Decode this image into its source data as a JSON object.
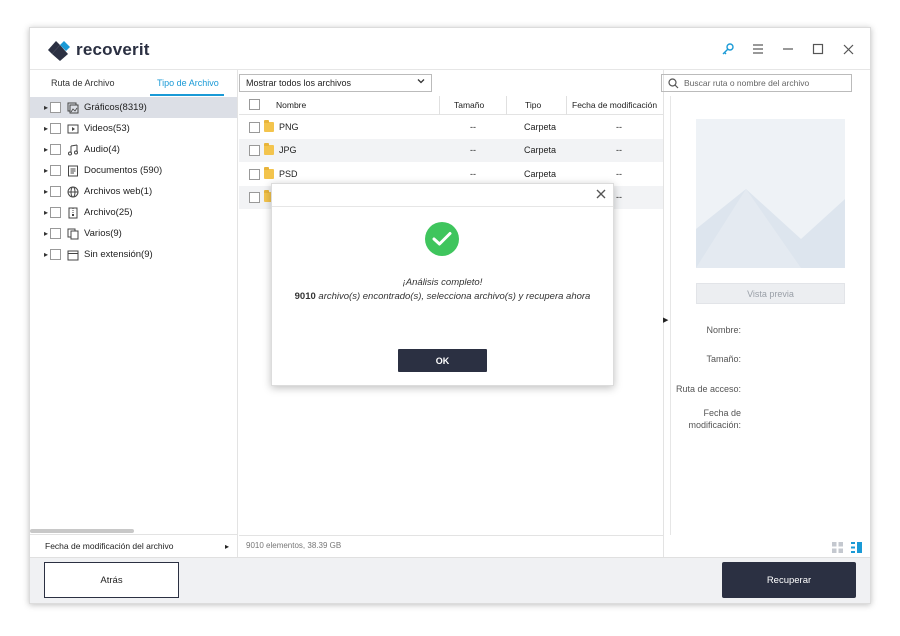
{
  "app": {
    "name": "recoverit"
  },
  "title_controls": [
    "key-icon",
    "menu-icon",
    "minimize-icon",
    "maximize-icon",
    "close-icon"
  ],
  "sidebar": {
    "tabs": [
      {
        "label": "Ruta de Archivo",
        "active": false
      },
      {
        "label": "Tipo de Archivo",
        "active": true
      }
    ],
    "items": [
      {
        "label": "Gráficos(8319)",
        "icon": "image-icon",
        "selected": true
      },
      {
        "label": "Videos(53)",
        "icon": "video-icon",
        "selected": false
      },
      {
        "label": "Audio(4)",
        "icon": "music-icon",
        "selected": false
      },
      {
        "label": "Documentos  (590)",
        "icon": "document-icon",
        "selected": false
      },
      {
        "label": "Archivos web(1)",
        "icon": "globe-icon",
        "selected": false
      },
      {
        "label": "Archivo(25)",
        "icon": "archive-icon",
        "selected": false
      },
      {
        "label": "Varios(9)",
        "icon": "misc-files-icon",
        "selected": false
      },
      {
        "label": "Sin extensión(9)",
        "icon": "blank-file-icon",
        "selected": false
      }
    ],
    "footer_label": "Fecha de modificación del archivo"
  },
  "main": {
    "filter": "Mostrar todos los archivos",
    "columns": [
      "Nombre",
      "Tamaño",
      "Tipo",
      "Fecha de modificación"
    ],
    "rows": [
      {
        "name": "PNG",
        "size": "--",
        "type": "Carpeta",
        "date": "--"
      },
      {
        "name": "JPG",
        "size": "--",
        "type": "Carpeta",
        "date": "--"
      },
      {
        "name": "PSD",
        "size": "--",
        "type": "Carpeta",
        "date": "--"
      },
      {
        "name": "",
        "size": "",
        "type": "",
        "date": "--"
      }
    ],
    "status": "9010 elementos, 38.39  GB"
  },
  "right_panel": {
    "search_placeholder": "Buscar ruta o nombre del archivo",
    "preview_button": "Vista previa",
    "meta": {
      "name": "Nombre:",
      "size": "Tamaño:",
      "path": "Ruta de acceso:",
      "date": "Fecha de modificación:"
    }
  },
  "bottom": {
    "back": "Atrás",
    "recover": "Recuperar"
  },
  "modal": {
    "line1": "¡Análisis completo!",
    "count": "9010",
    "line2": "archivo(s) encontrado(s), selecciona archivo(s) y recupera ahora",
    "ok": "OK"
  },
  "colors": {
    "accent": "#1a9ad6",
    "dark": "#2b3042",
    "success": "#3fc55d"
  }
}
